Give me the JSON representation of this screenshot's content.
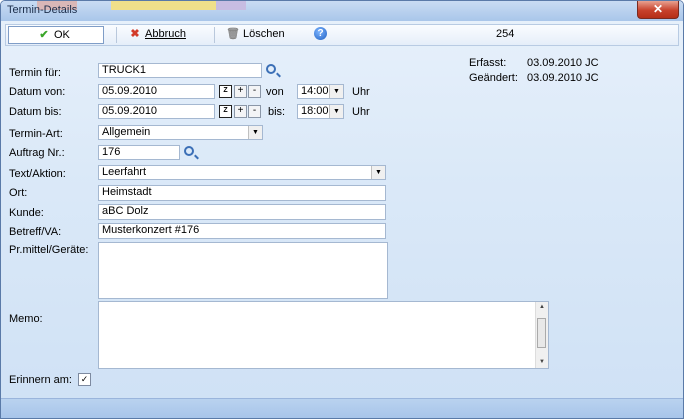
{
  "window": {
    "title": "Termin-Details",
    "close_symbol": "✕"
  },
  "toolbar": {
    "ok_label": "OK",
    "abbruch_label": "Abbruch",
    "loeschen_label": "Löschen",
    "record_number": "254"
  },
  "meta": {
    "erfasst_label": "Erfasst:",
    "erfasst_value": "03.09.2010  JC",
    "geaendert_label": "Geändert:",
    "geaendert_value": "03.09.2010  JC"
  },
  "form": {
    "termin_fuer_label": "Termin für:",
    "termin_fuer_value": "TRUCK1",
    "datum_von_label": "Datum von:",
    "datum_von_value": "05.09.2010",
    "von_label": "von",
    "von_time": "14:00",
    "uhr_label": "Uhr",
    "datum_bis_label": "Datum bis:",
    "datum_bis_value": "05.09.2010",
    "bis_label": "bis:",
    "bis_time": "18:00",
    "termin_art_label": "Termin-Art:",
    "termin_art_value": "Allgemein",
    "auftrag_label": "Auftrag Nr.:",
    "auftrag_value": "176",
    "text_aktion_label": "Text/Aktion:",
    "text_aktion_value": "Leerfahrt",
    "ort_label": "Ort:",
    "ort_value": "Heimstadt",
    "kunde_label": "Kunde:",
    "kunde_value": "aBC Dolz",
    "betreff_label": "Betreff/VA:",
    "betreff_value": "Musterkonzert #176",
    "prmittel_label": "Pr.mittel/Geräte:",
    "prmittel_value": "",
    "memo_label": "Memo:",
    "memo_value": "",
    "erinnern_label": "Erinnern am:",
    "erinnern_checked": "✓"
  },
  "colors": {
    "accent": "#1f5fc2",
    "ok_check": "#3aa62a",
    "cancel_x": "#d23b2a"
  }
}
